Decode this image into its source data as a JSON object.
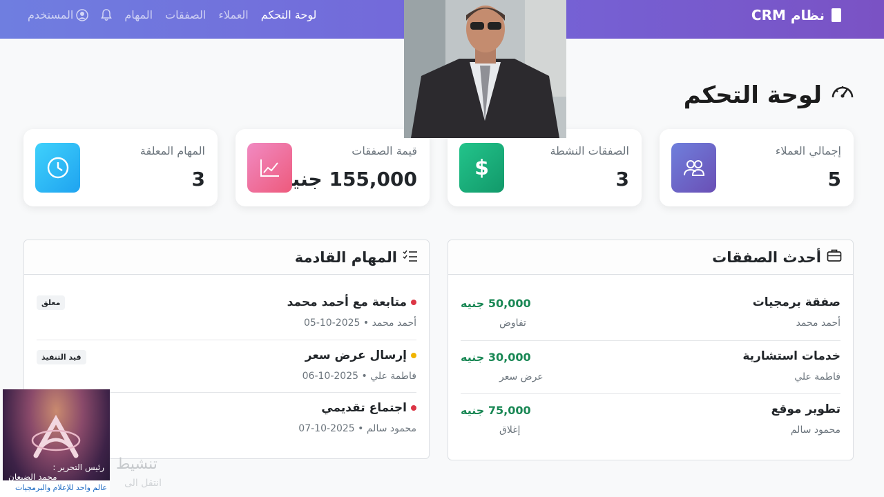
{
  "navbar": {
    "brand": "نظام CRM",
    "links": [
      {
        "label": "لوحة التحكم",
        "active": true
      },
      {
        "label": "العملاء"
      },
      {
        "label": "الصفقات"
      },
      {
        "label": "المهام"
      },
      {
        "label": "المستخدم"
      }
    ]
  },
  "page": {
    "title": "لوحة التحكم"
  },
  "stats": [
    {
      "label": "إجمالي العملاء",
      "value": "5",
      "icon": "users-icon",
      "color": "#6a5fc1"
    },
    {
      "label": "الصفقات النشطة",
      "value": "3",
      "icon": "dollar-icon",
      "color": "#20b37a"
    },
    {
      "label": "قيمة الصفقات",
      "value": "155,000 جنيه",
      "icon": "chart-line-icon",
      "color": "#ec6da0"
    },
    {
      "label": "المهام المعلقة",
      "value": "3",
      "icon": "clock-icon",
      "color": "#2bb9f5"
    }
  ],
  "deals": {
    "title": "أحدث الصفقات",
    "items": [
      {
        "name": "صفقة برمجيات",
        "client": "أحمد محمد",
        "amount": "50,000 جنيه",
        "stage": "تفاوض"
      },
      {
        "name": "خدمات استشارية",
        "client": "فاطمة علي",
        "amount": "30,000 جنيه",
        "stage": "عرض سعر"
      },
      {
        "name": "تطوير موقع",
        "client": "محمود سالم",
        "amount": "75,000 جنيه",
        "stage": "إغلاق"
      }
    ]
  },
  "tasks": {
    "title": "المهام القادمة",
    "items": [
      {
        "title": "متابعة مع أحمد محمد",
        "meta": "أحمد محمد • 2025-10-05",
        "badge": "معلق",
        "dot": "#dc3545"
      },
      {
        "title": "إرسال عرض سعر",
        "meta": "فاطمة علي • 2025-10-06",
        "badge": "قيد التنفيذ",
        "dot": "#f0b400"
      },
      {
        "title": "اجتماع تقديمي",
        "meta": "محمود سالم • 2025-10-07",
        "badge": "",
        "dot": "#dc3545"
      }
    ]
  },
  "activity": {
    "title": "تنشيط",
    "subtitle": "انتقل الى"
  },
  "overlay": {
    "editor_label": "رئيس التحرير :",
    "editor_name": "محمد الضبعان",
    "tagline": "عالم واحد للإعلام والبرمجيات"
  }
}
